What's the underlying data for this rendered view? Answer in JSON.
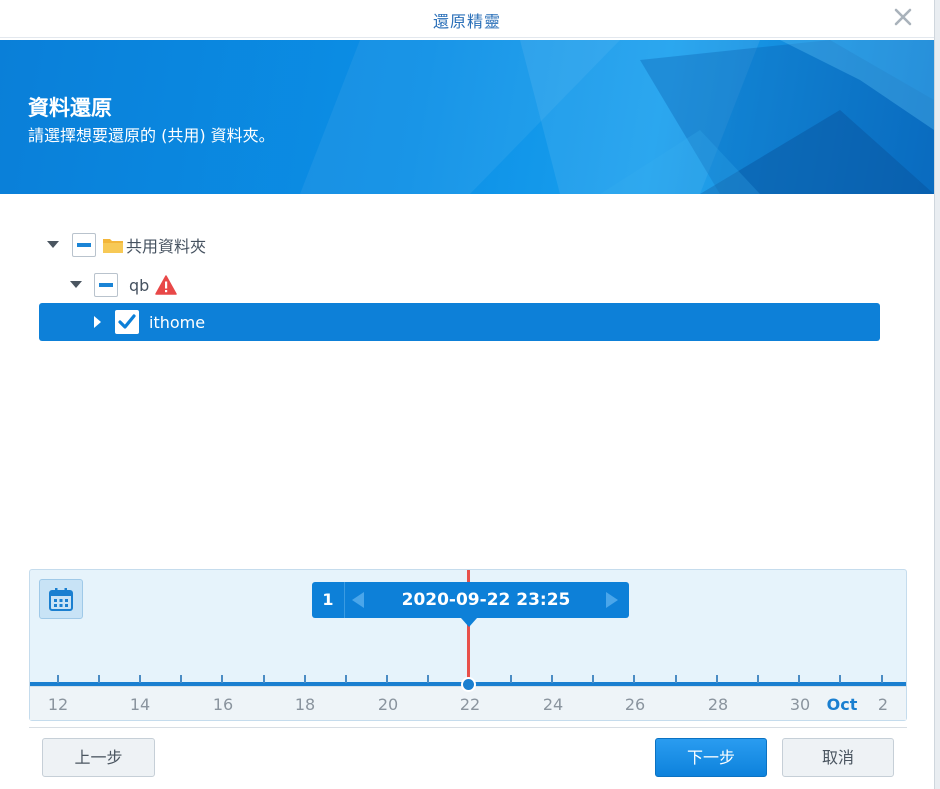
{
  "window": {
    "title": "還原精靈"
  },
  "banner": {
    "title": "資料還原",
    "subtitle": "請選擇想要還原的 (共用) 資料夾。"
  },
  "tree": {
    "root": {
      "label": "共用資料夾",
      "state": "partial",
      "expanded": true,
      "icon": "folder-icon"
    },
    "qb": {
      "label": "qb",
      "state": "partial",
      "expanded": true,
      "icon": "warning-icon"
    },
    "ithome": {
      "label": "ithome",
      "state": "checked",
      "expanded": false,
      "selected": true
    }
  },
  "timeline": {
    "version_count": "1",
    "current_datetime": "2020-09-22 23:25",
    "tick_labels": [
      "12",
      "14",
      "16",
      "18",
      "20",
      "22",
      "24",
      "26",
      "28",
      "30",
      "Oct",
      "2"
    ],
    "highlight_label": "Oct"
  },
  "footer": {
    "back_label": "上一步",
    "next_label": "下一步",
    "cancel_label": "取消"
  },
  "colors": {
    "accent": "#0d80d8",
    "cursor": "#e8504a",
    "warning": "#e84848"
  }
}
